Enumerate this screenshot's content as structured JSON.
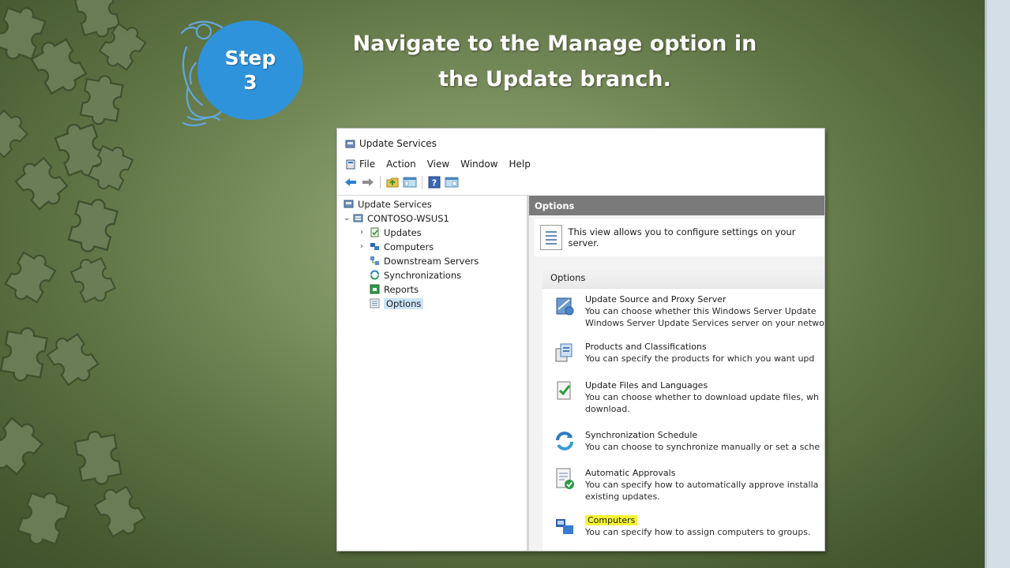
{
  "slide": {
    "step_label_line1": "Step",
    "step_label_line2": "3",
    "title_line1": "Navigate to the Manage option in",
    "title_line2": "the Update branch."
  },
  "window": {
    "title": "Update Services",
    "menu": [
      "File",
      "Action",
      "View",
      "Window",
      "Help"
    ],
    "toolbar_icons": [
      "back-arrow-icon",
      "forward-arrow-icon",
      "up-folder-icon",
      "console-tree-icon",
      "help-icon",
      "properties-icon"
    ],
    "tree": {
      "root": "Update Services",
      "server": "CONTOSO-WSUS1",
      "items": [
        "Updates",
        "Computers",
        "Downstream Servers",
        "Synchronizations",
        "Reports",
        "Options"
      ],
      "selected": "Options"
    },
    "content": {
      "header": "Options",
      "intro_text": "This view allows you to configure settings on your server.",
      "panel_title": "Options",
      "options": [
        {
          "title": "Update Source and Proxy Server",
          "desc1": "You can choose whether this Windows Server Update",
          "desc2": "Windows Server Update Services server on your netwo"
        },
        {
          "title": "Products and Classifications",
          "desc1": "You can specify the products for which you want upd",
          "desc2": ""
        },
        {
          "title": "Update Files and Languages",
          "desc1": "You can choose whether to download update files, wh",
          "desc2": "download."
        },
        {
          "title": "Synchronization Schedule",
          "desc1": "You can choose to synchronize manually or set a sche",
          "desc2": ""
        },
        {
          "title": "Automatic Approvals",
          "desc1": "You can specify how to automatically approve installa",
          "desc2": "existing updates."
        },
        {
          "title": "Computers",
          "desc1": "You can specify how to assign computers to groups.",
          "desc2": ""
        }
      ],
      "highlighted_option": "Computers",
      "highlight_color": "#f6f535"
    }
  },
  "colors": {
    "step_circle": "#2f93dc",
    "selection": "#cce4f7",
    "content_header": "#7a7a7a",
    "right_strip": "#d3dee6"
  }
}
